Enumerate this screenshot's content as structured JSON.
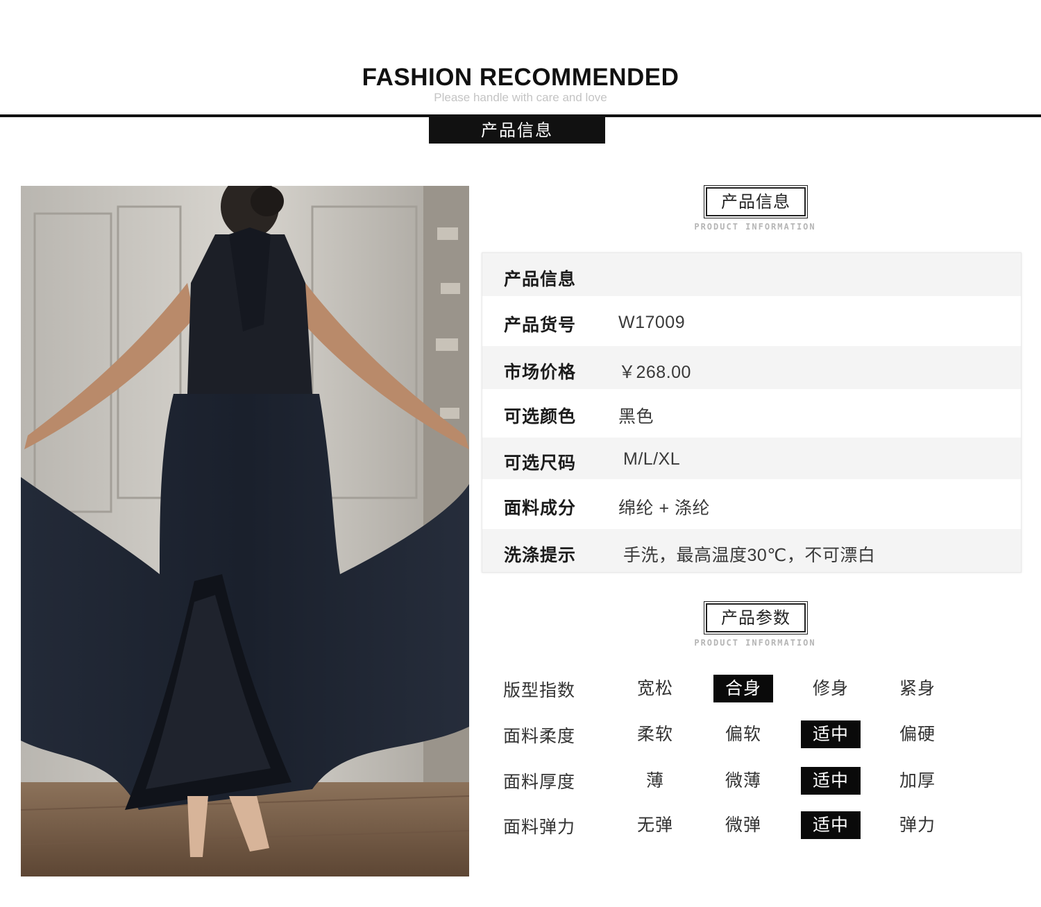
{
  "header": {
    "title": "FASHION RECOMMENDED",
    "subtitle": "Please handle with care and love",
    "tab_label": "产品信息"
  },
  "info_section": {
    "title": "产品信息",
    "subtitle_en": "PRODUCT INFORMATION",
    "rows": [
      {
        "label": "产品信息",
        "value": ""
      },
      {
        "label": "产品货号",
        "value": "W17009"
      },
      {
        "label": "市场价格",
        "value": "￥268.00"
      },
      {
        "label": "可选颜色",
        "value": "黑色"
      },
      {
        "label": "可选尺码",
        "value": "M/L/XL"
      },
      {
        "label": "面料成分",
        "value": "绵纶 + 涤纶"
      },
      {
        "label": "洗涤提示",
        "value": "手洗，最高温度30℃，不可漂白"
      }
    ]
  },
  "params_section": {
    "title": "产品参数",
    "subtitle_en": "PRODUCT INFORMATION",
    "rows": [
      {
        "label": "版型指数",
        "options": [
          "宽松",
          "合身",
          "修身",
          "紧身"
        ],
        "selected_index": 1
      },
      {
        "label": "面料柔度",
        "options": [
          "柔软",
          "偏软",
          "适中",
          "偏硬"
        ],
        "selected_index": 2
      },
      {
        "label": "面料厚度",
        "options": [
          "薄",
          "微薄",
          "适中",
          "加厚"
        ],
        "selected_index": 2
      },
      {
        "label": "面料弹力",
        "options": [
          "无弹",
          "微弹",
          "适中",
          "弹力"
        ],
        "selected_index": 2
      }
    ]
  },
  "colors": {
    "accent": "#111111",
    "row_stripe": "#f4f4f4",
    "dress": "#1b2230"
  }
}
